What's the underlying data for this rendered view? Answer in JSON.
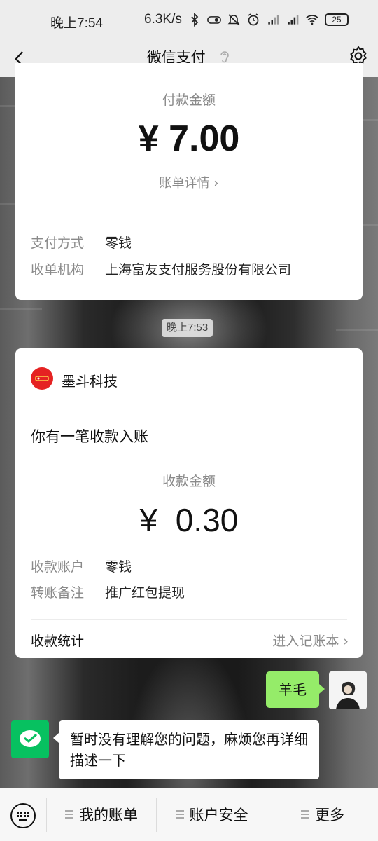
{
  "status_bar": {
    "time": "晚上7:54",
    "net_speed": "6.3K/s",
    "battery": "25"
  },
  "nav": {
    "title": "微信支付"
  },
  "payment_card": {
    "amount_label": "付款金额",
    "amount": "¥ 7.00",
    "details_link": "账单详情 ›",
    "rows": [
      {
        "label": "支付方式",
        "value": "零钱"
      },
      {
        "label": "收单机构",
        "value": "上海富友支付服务股份有限公司"
      }
    ]
  },
  "timestamp": "晚上7:53",
  "receipt_card": {
    "merchant": "墨斗科技",
    "notice": "你有一笔收款入账",
    "amount_label": "收款金额",
    "amount": "¥  0.30",
    "rows": [
      {
        "label": "收款账户",
        "value": "零钱"
      },
      {
        "label": "转账备注",
        "value": "推广红包提现"
      }
    ],
    "stats_label": "收款统计",
    "stats_link": "进入记账本 ›"
  },
  "messages": {
    "sent": "羊毛",
    "reply": "暂时没有理解您的问题，麻烦您再详细描述一下"
  },
  "bottom_menu": {
    "items": [
      "我的账单",
      "账户安全",
      "更多"
    ]
  },
  "colors": {
    "bubble_sent": "#95ec69",
    "wechat_pay_green": "#07c160",
    "merchant_logo": "#e52222"
  }
}
